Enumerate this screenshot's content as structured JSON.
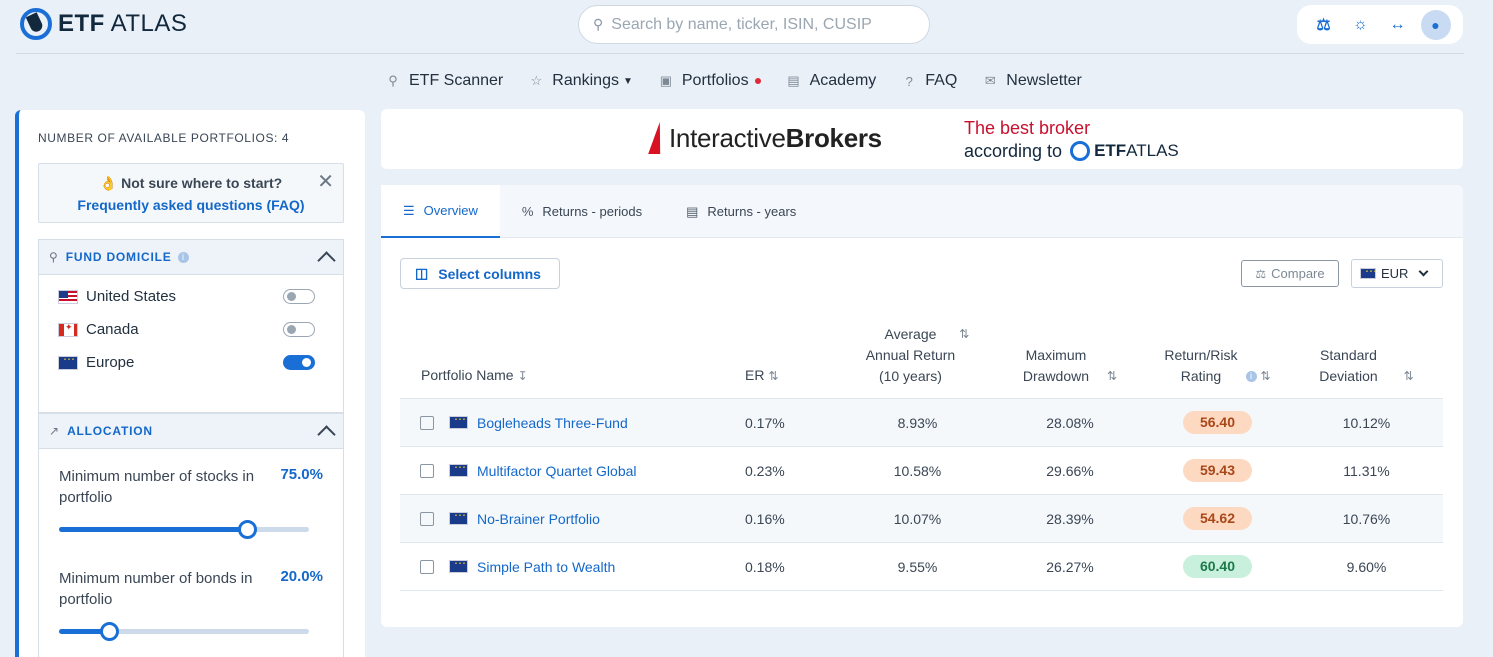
{
  "header": {
    "logo_text_bold": "ETF",
    "logo_text_rest": " ATLAS",
    "search_placeholder": "Search by name, ticker, ISIN, CUSIP",
    "tools": [
      "compare-scale-icon",
      "sun-icon",
      "arrows-icon",
      "user-icon"
    ]
  },
  "nav": [
    {
      "label": "ETF Scanner",
      "icon": "search-icon"
    },
    {
      "label": "Rankings",
      "icon": "star-icon",
      "has_dropdown": true
    },
    {
      "label": "Portfolios",
      "icon": "briefcase-icon",
      "has_dot": true
    },
    {
      "label": "Academy",
      "icon": "book-icon"
    },
    {
      "label": "FAQ",
      "icon": "question-icon"
    },
    {
      "label": "Newsletter",
      "icon": "mail-icon"
    }
  ],
  "sidebar": {
    "count_label": "NUMBER OF AVAILABLE PORTFOLIOS: 4",
    "faq_question": "👌 Not sure where to start?",
    "faq_link": "Frequently asked questions (FAQ)",
    "domicile": {
      "title": "FUND DOMICILE",
      "options": [
        {
          "name": "United States",
          "flag": "us",
          "on": false
        },
        {
          "name": "Canada",
          "flag": "ca",
          "on": false
        },
        {
          "name": "Europe",
          "flag": "eu",
          "on": true
        }
      ]
    },
    "allocation": {
      "title": "ALLOCATION",
      "items": [
        {
          "label": "Minimum number of stocks in portfolio",
          "value": "75.0%",
          "fraction": 0.75
        },
        {
          "label": "Minimum number of bonds in portfolio",
          "value": "20.0%",
          "fraction": 0.2
        }
      ]
    }
  },
  "banner": {
    "ib_light": "Interactive",
    "ib_bold": "Brokers",
    "line1": "The best broker",
    "line2": "according to",
    "logo_bold": "ETF",
    "logo_rest": " ATLAS"
  },
  "tabs": [
    {
      "label": "Overview",
      "icon": "list-icon",
      "active": true
    },
    {
      "label": "Returns - periods",
      "icon": "percent-icon",
      "active": false
    },
    {
      "label": "Returns - years",
      "icon": "calendar-icon",
      "active": false
    }
  ],
  "toolbar": {
    "select_columns": "Select columns",
    "compare": "Compare",
    "currency": "EUR"
  },
  "table": {
    "headers": {
      "name": "Portfolio Name",
      "er": "ER",
      "avg_return": [
        "Average",
        "Annual Return",
        "(10 years)"
      ],
      "drawdown": [
        "Maximum",
        "Drawdown"
      ],
      "rating": [
        "Return/Risk",
        "Rating"
      ],
      "stdev": [
        "Standard",
        "Deviation"
      ]
    },
    "rows": [
      {
        "name": "Bogleheads Three-Fund",
        "er": "0.17%",
        "avg_return": "8.93%",
        "drawdown": "28.08%",
        "rating": "56.40",
        "rating_color": "orange",
        "stdev": "10.12%"
      },
      {
        "name": "Multifactor Quartet Global",
        "er": "0.23%",
        "avg_return": "10.58%",
        "drawdown": "29.66%",
        "rating": "59.43",
        "rating_color": "orange",
        "stdev": "11.31%"
      },
      {
        "name": "No-Brainer Portfolio",
        "er": "0.16%",
        "avg_return": "10.07%",
        "drawdown": "28.39%",
        "rating": "54.62",
        "rating_color": "orange",
        "stdev": "10.76%"
      },
      {
        "name": "Simple Path to Wealth",
        "er": "0.18%",
        "avg_return": "9.55%",
        "drawdown": "26.27%",
        "rating": "60.40",
        "rating_color": "green",
        "stdev": "9.60%"
      }
    ]
  }
}
